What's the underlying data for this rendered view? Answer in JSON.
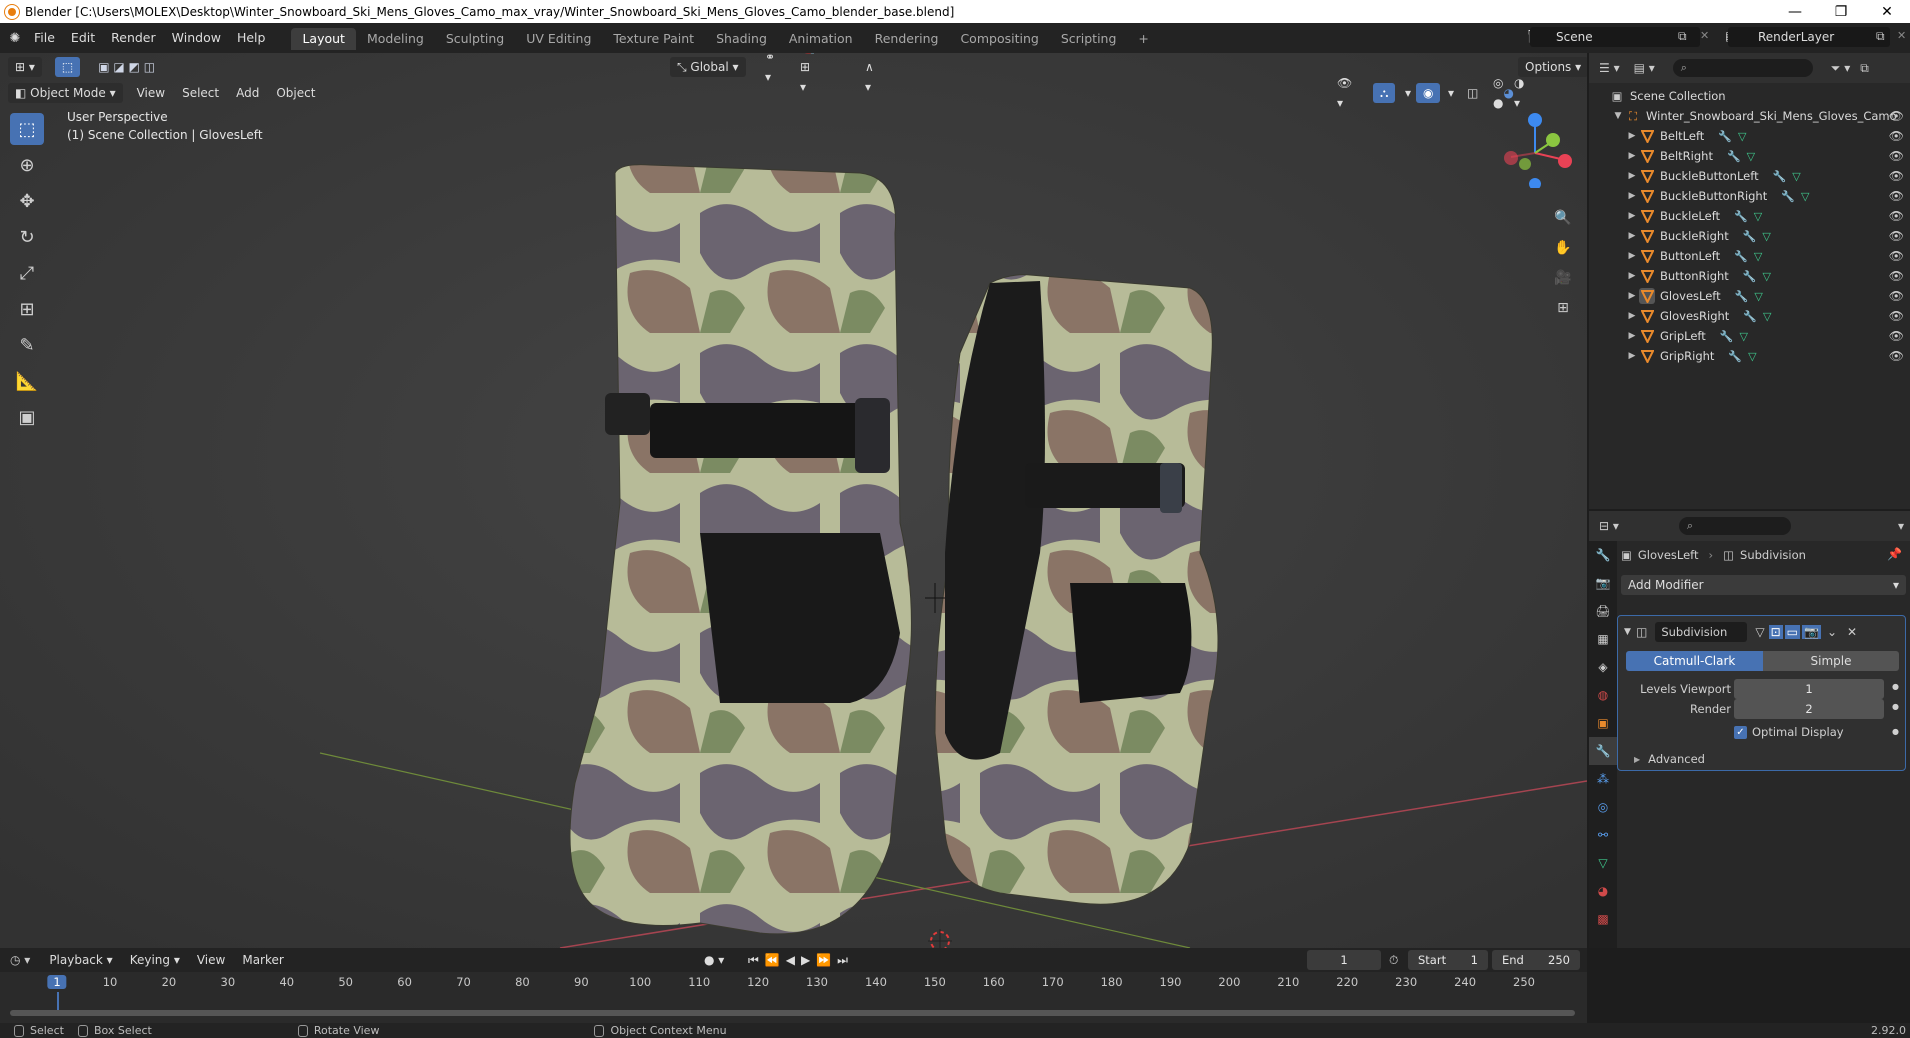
{
  "window": {
    "title": "Blender [C:\\Users\\MOLEX\\Desktop\\Winter_Snowboard_Ski_Mens_Gloves_Camo_max_vray/Winter_Snowboard_Ski_Mens_Gloves_Camo_blender_base.blend]",
    "minimize": "—",
    "restore": "❐",
    "close": "✕"
  },
  "menu": [
    "File",
    "Edit",
    "Render",
    "Window",
    "Help"
  ],
  "workspaces": [
    "Layout",
    "Modeling",
    "Sculpting",
    "UV Editing",
    "Texture Paint",
    "Shading",
    "Animation",
    "Rendering",
    "Compositing",
    "Scripting"
  ],
  "workspace_add": "+",
  "scene": {
    "name": "Scene",
    "view_layer": "RenderLayer"
  },
  "viewport": {
    "mode": "Object Mode",
    "menus": [
      "View",
      "Select",
      "Add",
      "Object"
    ],
    "transform_orientation": "Global",
    "options": "Options",
    "perspective": "User Perspective",
    "collection_info": "(1) Scene Collection | GlovesLeft"
  },
  "tools": [
    "select-box",
    "cursor",
    "move",
    "rotate",
    "scale",
    "transform",
    "annotate",
    "measure",
    "add-cube"
  ],
  "outliner": {
    "search_placeholder": "",
    "root": "Scene Collection",
    "collection": "Winter_Snowboard_Ski_Mens_Gloves_Camo",
    "objects": [
      "BeltLeft",
      "BeltRight",
      "BuckleButtonLeft",
      "BuckleButtonRight",
      "BuckleLeft",
      "BuckleRight",
      "ButtonLeft",
      "ButtonRight",
      "GlovesLeft",
      "GlovesRight",
      "GripLeft",
      "GripRight"
    ],
    "selected": "GlovesLeft"
  },
  "properties": {
    "object": "GlovesLeft",
    "modifier_context": "Subdivision",
    "add_modifier": "Add Modifier",
    "modifier_name": "Subdivision",
    "algorithm_options": [
      "Catmull-Clark",
      "Simple"
    ],
    "algorithm_selected": "Catmull-Clark",
    "levels_viewport_label": "Levels Viewport",
    "levels_viewport": "1",
    "render_label": "Render",
    "render": "2",
    "optimal_display_label": "Optimal Display",
    "optimal_display": true,
    "advanced": "Advanced"
  },
  "timeline": {
    "menus": [
      "Playback",
      "Keying",
      "View",
      "Marker"
    ],
    "current_frame": "1",
    "start_label": "Start",
    "start": "1",
    "end_label": "End",
    "end": "250",
    "ticks": [
      "1",
      "10",
      "20",
      "30",
      "40",
      "50",
      "60",
      "70",
      "80",
      "90",
      "100",
      "110",
      "120",
      "130",
      "140",
      "150",
      "160",
      "170",
      "180",
      "190",
      "200",
      "210",
      "220",
      "230",
      "240",
      "250"
    ]
  },
  "status": {
    "select": "Select",
    "box_select": "Box Select",
    "rotate_view": "Rotate View",
    "context_menu": "Object Context Menu",
    "version": "2.92.0"
  },
  "colors": {
    "accent": "#4772b3",
    "x_axis": "#e84255",
    "y_axis": "#8bc540",
    "z_axis": "#3d8af0",
    "mesh_icon": "#e98a2c"
  }
}
